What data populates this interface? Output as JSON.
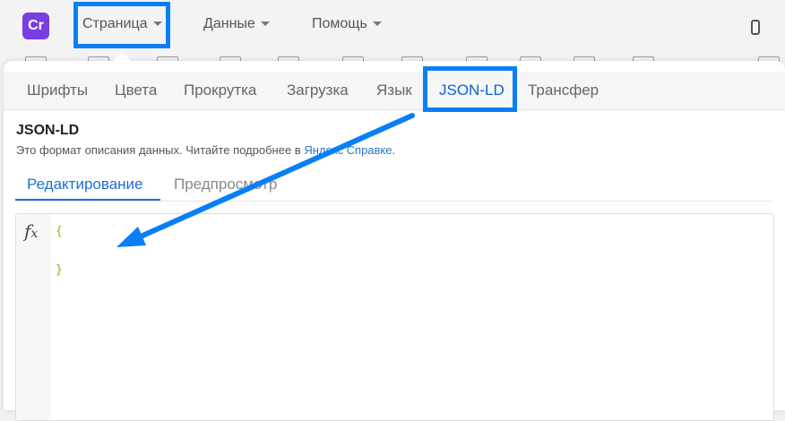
{
  "app": {
    "logo_text": "Cr",
    "brand_color": "#7a3de0"
  },
  "menubar": {
    "items": [
      {
        "label": "Страница",
        "icon": "chevron-down-icon",
        "highlighted": true
      },
      {
        "label": "Данные",
        "icon": "chevron-down-icon"
      },
      {
        "label": "Помощь",
        "icon": "chevron-down-icon"
      }
    ],
    "device_icon": "mobile-phone-icon"
  },
  "settings_tabs": {
    "items": [
      "Шрифты",
      "Цвета",
      "Прокрутка",
      "Загрузка",
      "Язык",
      "JSON-LD",
      "Трансфер"
    ],
    "active": "JSON-LD"
  },
  "section": {
    "title": "JSON-LD",
    "description_text": "Это формат описания данных. Читайте подробнее в ",
    "description_link": "Яндекс Справке",
    "description_end": "."
  },
  "editor_tabs": {
    "items": [
      "Редактирование",
      "Предпросмотр"
    ],
    "active": "Редактирование"
  },
  "editor": {
    "gutter_icon": "function-fx-icon",
    "lines": [
      "{",
      "}"
    ]
  },
  "annotation": {
    "color": "#0a7ff5",
    "arrow_icon": "arrow-icon"
  }
}
